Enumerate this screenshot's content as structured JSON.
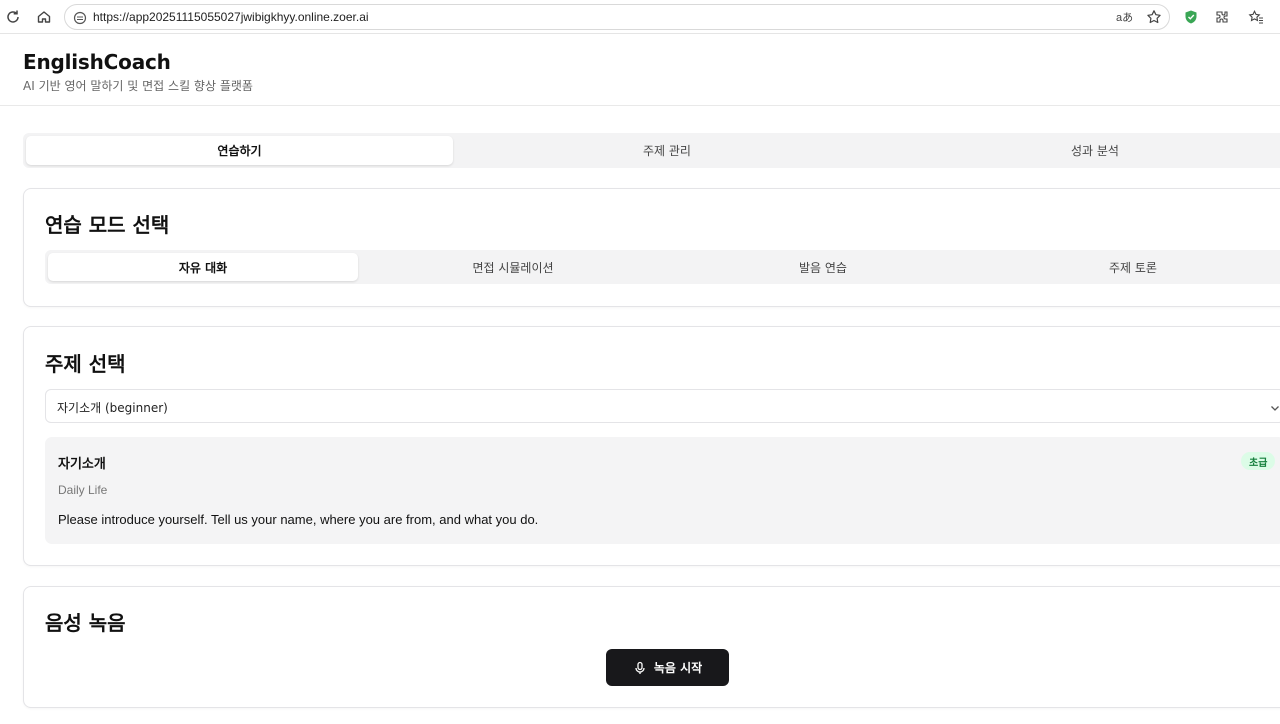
{
  "browser": {
    "url": "https://app20251115055027jwibigkhyy.online.zoer.ai",
    "icons": [
      "reload-icon",
      "home-icon",
      "site-info-icon",
      "translate-icon",
      "star-icon",
      "shield-icon",
      "extensions-icon",
      "favorites-icon"
    ],
    "translate_label": "aあ"
  },
  "header": {
    "title": "EnglishCoach",
    "subtitle": "AI 기반 영어 말하기 및 면접 스킬 향상 플랫폼"
  },
  "main_tabs": [
    {
      "label": "연습하기",
      "active": true
    },
    {
      "label": "주제 관리",
      "active": false
    },
    {
      "label": "성과 분석",
      "active": false
    }
  ],
  "practice_mode": {
    "title": "연습 모드 선택",
    "tabs": [
      {
        "label": "자유 대화",
        "active": true
      },
      {
        "label": "면접 시뮬레이션",
        "active": false
      },
      {
        "label": "발음 연습",
        "active": false
      },
      {
        "label": "주제 토론",
        "active": false
      }
    ]
  },
  "topic": {
    "title": "주제 선택",
    "selected": "자기소개 (beginner)",
    "card": {
      "name": "자기소개",
      "category": "Daily Life",
      "prompt": "Please introduce yourself. Tell us your name, where you are from, and what you do.",
      "level": "초급"
    }
  },
  "recording": {
    "title": "음성 녹음",
    "button_label": "녹음 시작"
  },
  "colors": {
    "primary": "#18181b",
    "badge_bg": "#dcfce7",
    "badge_text": "#15803d",
    "muted_bg": "#f3f3f4"
  }
}
